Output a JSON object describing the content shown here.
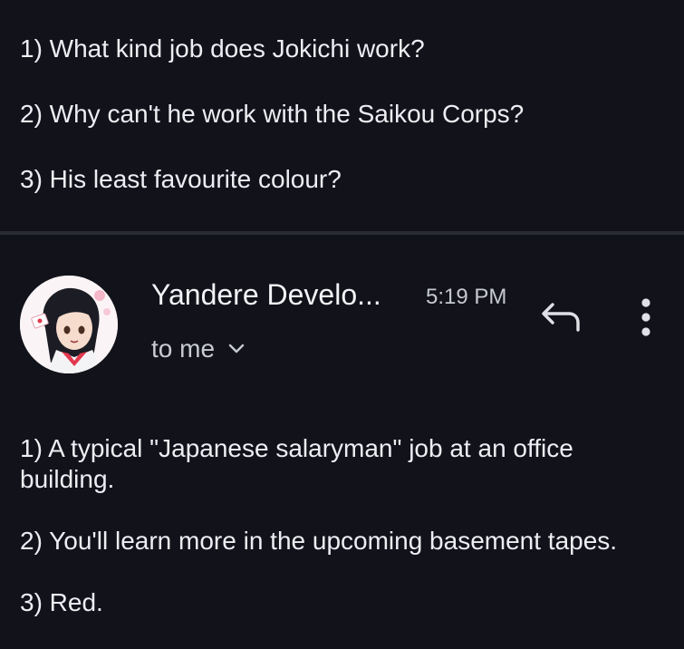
{
  "thread": {
    "previous_message": {
      "lines": [
        "1) What kind job does Jokichi work?",
        "2) Why can't he work with the Saikou Corps?",
        "3) His least favourite colour?"
      ]
    },
    "message": {
      "sender": "Yandere Develo...",
      "time": "5:19 PM",
      "recipient": "to me",
      "lines": [
        "1) A typical \"Japanese salaryman\" job at an office building.",
        "2) You'll learn more in the upcoming basement tapes.",
        "3) Red."
      ]
    }
  },
  "icons": {
    "avatar": "avatar",
    "reply": "reply-icon",
    "more": "more-vert-icon",
    "expand": "chevron-down-icon"
  },
  "colors": {
    "background": "#12131a",
    "text": "#eceef2",
    "secondary_text": "#c9cbd3",
    "divider": "#2a2c35"
  }
}
